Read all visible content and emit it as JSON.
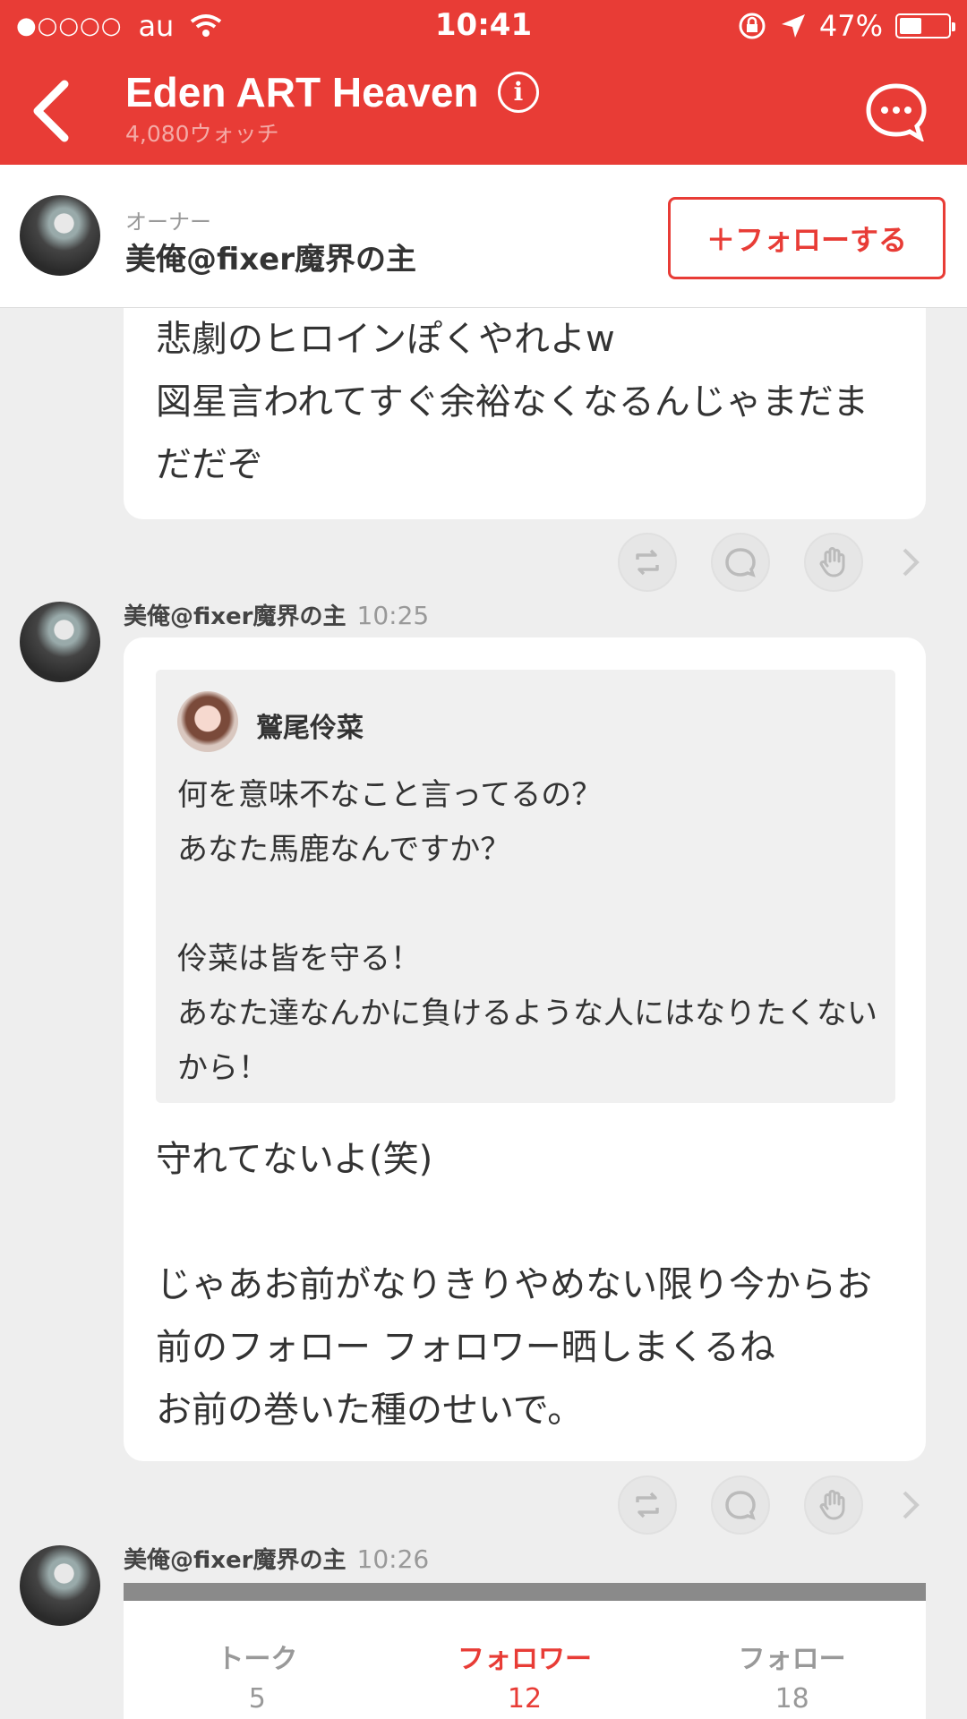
{
  "status_bar": {
    "signal": "●○○○○",
    "carrier": "au",
    "time": "10:41",
    "battery": "47%",
    "battery_level": 0.47
  },
  "header": {
    "title": "Eden ART Heaven",
    "watch_count": "4,080ウォッチ"
  },
  "owner": {
    "role": "オーナー",
    "name": "美俺@fixer魔界の主",
    "follow_label": "＋フォローする"
  },
  "messages": [
    {
      "text": "悲劇のヒロインぽくやれよw\n図星言われてすぐ余裕なくなるんじゃまだまだだぞ"
    },
    {
      "author": "美俺@fixer魔界の主",
      "time": "10:25",
      "quote": {
        "author": "鷲尾伶菜",
        "text": "何を意味不なこと言ってるの？\nあなた馬鹿なんですか？\n\n伶菜は皆を守る！\nあなた達なんかに負けるような人にはなりたくないから！"
      },
      "text": "守れてないよ(笑)\n\nじゃあお前がなりきりやめない限り今からお前のフォロー フォロワー晒しまくるね\nお前の巻いた種のせいで。"
    },
    {
      "author": "美俺@fixer魔界の主",
      "time": "10:26",
      "stats": [
        {
          "label": "トーク",
          "value": "5"
        },
        {
          "label": "フォロワー",
          "value": "12"
        },
        {
          "label": "フォロー",
          "value": "18"
        }
      ]
    }
  ],
  "colors": {
    "accent": "#e83c36",
    "background": "#eeeeee"
  },
  "icons": [
    "back-arrow-icon",
    "info-icon",
    "chat-icon",
    "retweet-icon",
    "comment-icon",
    "clap-icon",
    "chevron-right-icon",
    "wifi-icon",
    "location-icon",
    "rotation-lock-icon"
  ]
}
